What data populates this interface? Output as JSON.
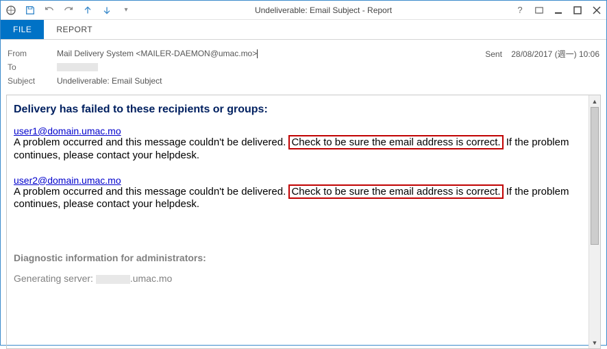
{
  "window": {
    "title": "Undeliverable: Email Subject - Report"
  },
  "ribbon": {
    "file_label": "FILE",
    "report_label": "REPORT"
  },
  "header": {
    "from_label": "From",
    "from_value": "Mail Delivery System <MAILER-DAEMON@umac.mo>",
    "to_label": "To",
    "subject_label": "Subject",
    "subject_value": "Undeliverable: Email Subject",
    "sent_label": "Sent",
    "sent_value": "28/08/2017 (週一) 10:06"
  },
  "body": {
    "heading": "Delivery has failed to these recipients or groups:",
    "errors": [
      {
        "recipient": "user1@domain.umac.mo",
        "msg_before": "A problem occurred and this message couldn't be delivered.",
        "msg_boxed": "Check to be sure the email address is correct.",
        "msg_after": "If the problem continues, please contact your helpdesk."
      },
      {
        "recipient": "user2@domain.umac.mo",
        "msg_before": "A problem occurred and this message couldn't be delivered.",
        "msg_boxed": "Check to be sure the email address is correct.",
        "msg_after": "If the problem continues, please contact your helpdesk."
      }
    ],
    "diag_header": "Diagnostic information for administrators:",
    "diag_server_prefix": "Generating server: ",
    "diag_server_suffix": ".umac.mo"
  }
}
